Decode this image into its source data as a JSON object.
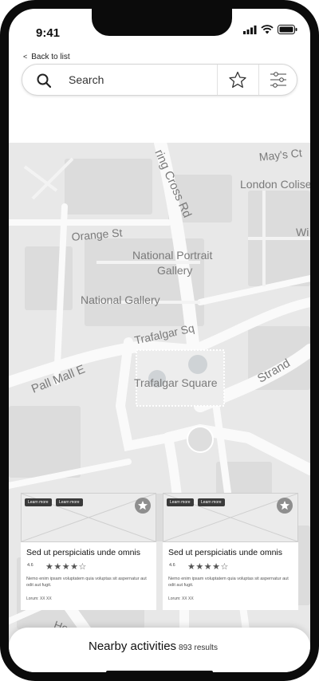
{
  "status_bar": {
    "time": "9:41"
  },
  "nav": {
    "back_label": "Back to list"
  },
  "search": {
    "placeholder": "Search"
  },
  "map": {
    "labels": {
      "charing_cross_rd": "ring Cross Rd",
      "mays_ct": "May's Ct",
      "london_coli": "London Colise",
      "orange_st": "Orange St",
      "wi": "Wi",
      "national_portrait_gallery_1": "National Portrait",
      "national_portrait_gallery_2": "Gallery",
      "national_gallery": "National Gallery",
      "trafalgar_sq": "Trafalgar Sq",
      "pall_mall_e": "Pall Mall E",
      "trafalgar_square": "Trafalgar Square",
      "strand": "Strand",
      "horse": "Horse"
    }
  },
  "cards": [
    {
      "tags": [
        "Learn more",
        "Learn more"
      ],
      "title": "Sed ut perspiciatis unde omnis",
      "rating": "4.6",
      "stars": "★★★★☆",
      "description": "Nemo enim ipsam voluptatem quia voluptas sit aspernatur aut odit aut fugit.",
      "meta": "Lorum: XX XX"
    },
    {
      "tags": [
        "Learn more",
        "Learn more"
      ],
      "title": "Sed ut perspiciatis unde omnis",
      "rating": "4.6",
      "stars": "★★★★☆",
      "description": "Nemo enim ipsam voluptatem quia voluptas sit aspernatur aut odit aut fugit.",
      "meta": "Lorum: XX XX"
    }
  ],
  "sheet": {
    "title": "Nearby activities",
    "count": "893 results"
  }
}
